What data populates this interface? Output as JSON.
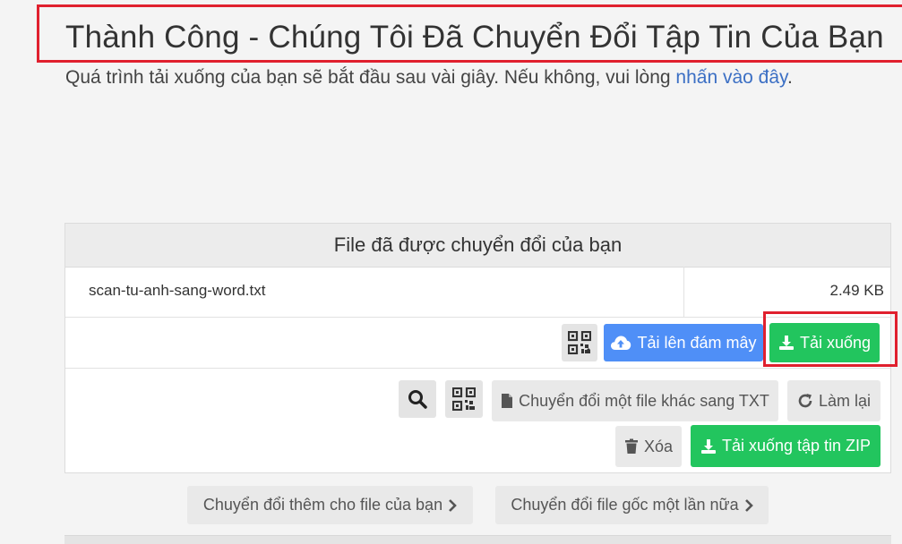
{
  "header": {
    "title": "Thành Công - Chúng Tôi Đã Chuyển Đổi Tập Tin Của Bạn",
    "subtitle_prefix": "Quá trình tải xuống của bạn sẽ bắt đầu sau vài giây. Nếu không, vui lòng ",
    "subtitle_link": "nhấn vào đây",
    "subtitle_suffix": "."
  },
  "panel": {
    "title": "File đã được chuyển đổi của bạn",
    "file_name": "scan-tu-anh-sang-word.txt",
    "file_size": "2.49 KB"
  },
  "actions": {
    "upload_cloud": "Tải lên đám mây",
    "download": "Tải xuống",
    "convert_other": "Chuyển đổi một file khác sang TXT",
    "redo": "Làm lại",
    "delete": "Xóa",
    "download_zip": "Tải xuống tập tin ZIP"
  },
  "footer": {
    "convert_more": "Chuyển đổi thêm cho file của bạn",
    "convert_original_again": "Chuyển đổi file gốc một lần nữa"
  },
  "icons": {
    "qr": "qr-code-icon",
    "cloud": "cloud-upload-icon",
    "download": "download-icon",
    "search": "search-icon",
    "file": "file-icon",
    "redo": "redo-icon",
    "trash": "trash-icon",
    "chevron": "chevron-right-icon"
  },
  "colors": {
    "green": "#22c55e",
    "blue": "#4f8ff7",
    "link": "#3b6fc4",
    "highlight": "#e0202e"
  }
}
